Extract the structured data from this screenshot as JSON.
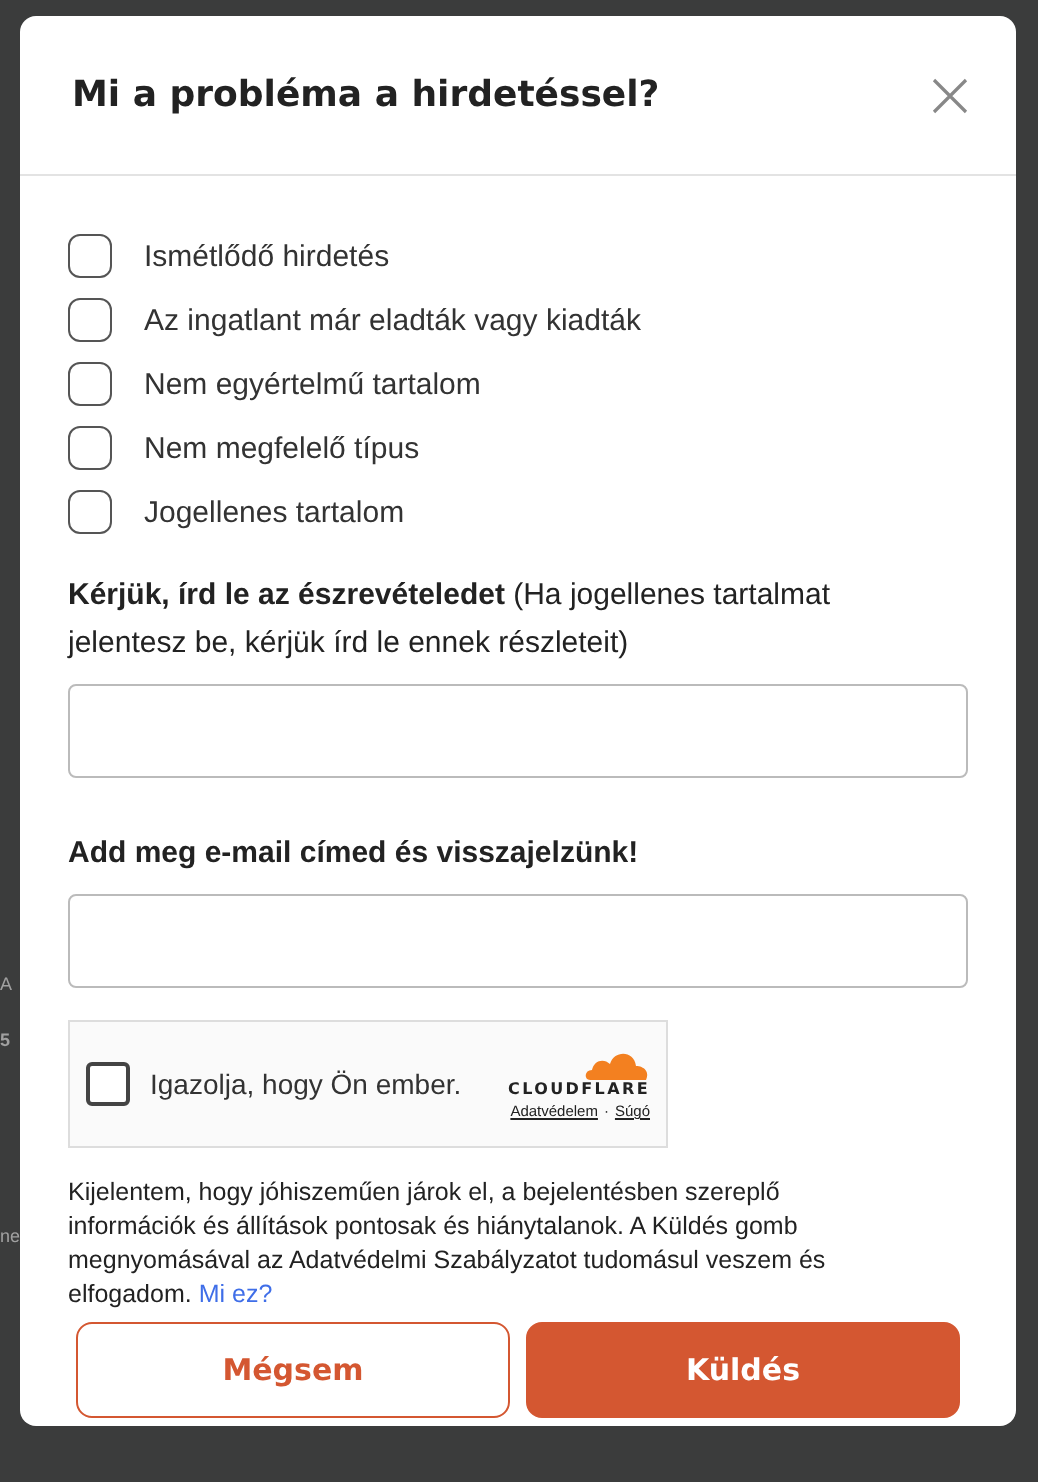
{
  "background_fragments": [
    "A",
    "5",
    "ne"
  ],
  "dialog": {
    "title": "Mi a probléma a hirdetéssel?"
  },
  "reasons": [
    {
      "label": "Ismétlődő hirdetés",
      "checked": false
    },
    {
      "label": "Az ingatlant már eladták vagy kiadták",
      "checked": false
    },
    {
      "label": "Nem egyértelmű tartalom",
      "checked": false
    },
    {
      "label": "Nem megfelelő típus",
      "checked": false
    },
    {
      "label": "Jogellenes tartalom",
      "checked": false
    }
  ],
  "comment": {
    "label": "**Kérjük, írd le az észrevételedet** (Ha jogellenes tartalmat jelentesz be, kérjük írd le ennek részleteit)"
  },
  "email": {
    "label": "Add meg e-mail címed és visszajelzünk!"
  },
  "captcha": {
    "label": "Igazolja, hogy Ön ember.",
    "checked": false,
    "brand": "CLOUDFLARE",
    "links": [
      "Adatvédelem",
      "Súgó"
    ],
    "separator": "·"
  },
  "disclaimer": {
    "text": "Kijelentem, hogy jóhiszeműen járok el, a bejelentésben szereplő információk és állítások pontosak és hiánytalanok. A Küldés gomb megnyomásával az Adatvédelmi Szabályzatot tudomásul veszem és elfogadom.",
    "link": "Mi ez?"
  },
  "buttons": [
    {
      "label": "Mégsem",
      "kind": "secondary"
    },
    {
      "label": "Küldés",
      "kind": "primary"
    }
  ]
}
